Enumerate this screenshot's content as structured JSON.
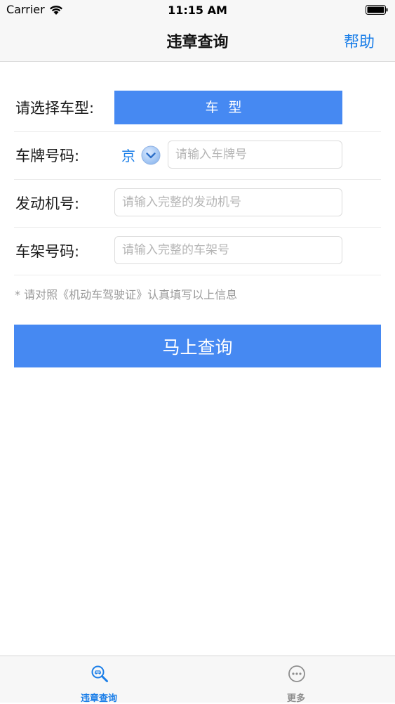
{
  "status_bar": {
    "carrier": "Carrier",
    "time": "11:15 AM"
  },
  "nav": {
    "title": "违章查询",
    "help": "帮助"
  },
  "form": {
    "car_type": {
      "label": "请选择车型:",
      "button": "车型"
    },
    "plate": {
      "label": "车牌号码:",
      "province": "京",
      "placeholder": "请输入车牌号"
    },
    "engine": {
      "label": "发动机号:",
      "placeholder": "请输入完整的发动机号"
    },
    "frame": {
      "label": "车架号码:",
      "placeholder": "请输入完整的车架号"
    },
    "note": "* 请对照《机动车驾驶证》认真填写以上信息"
  },
  "query_button": "马上查询",
  "tab_bar": {
    "tabs": [
      {
        "label": "违章查询",
        "icon": "search-car-icon",
        "active": true
      },
      {
        "label": "更多",
        "icon": "more-icon",
        "active": false
      }
    ]
  },
  "colors": {
    "accent": "#4689f2",
    "link": "#1a7ee8",
    "tab_inactive": "#8e8e8e"
  }
}
